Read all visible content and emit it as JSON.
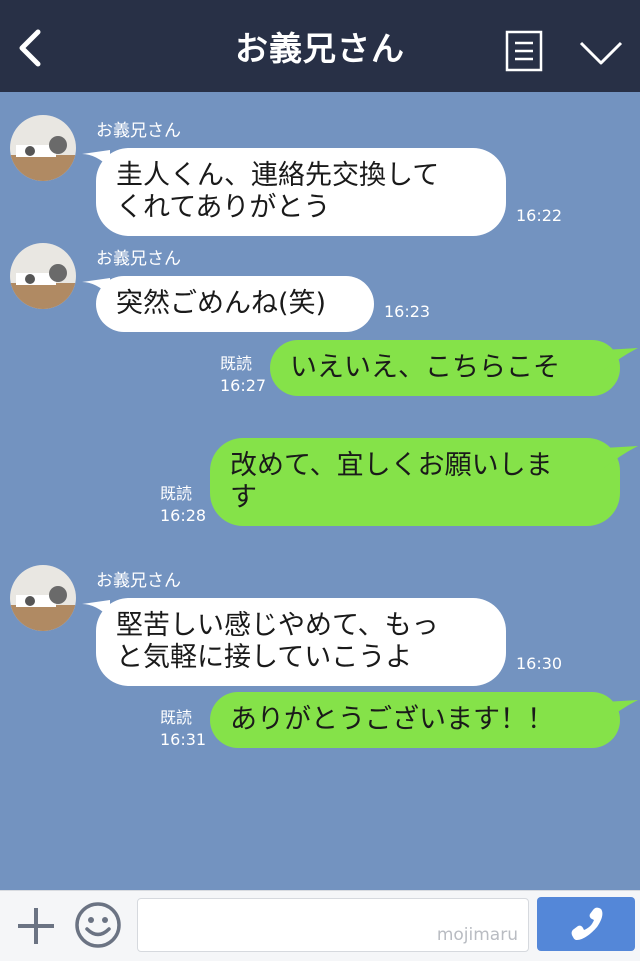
{
  "header": {
    "title": "お義兄さん"
  },
  "messages": [
    {
      "sender": "お義兄さん",
      "lines": [
        "圭人くん、連絡先交換して",
        "くれてありがとう"
      ],
      "time": "16:22"
    },
    {
      "sender": "お義兄さん",
      "lines": [
        "突然ごめんね(笑)"
      ],
      "time": "16:23"
    },
    {
      "read": "既読",
      "lines": [
        "いえいえ、こちらこそ"
      ],
      "time": "16:27"
    },
    {
      "read": "既読",
      "lines": [
        "改めて、宜しくお願いしま",
        "す"
      ],
      "time": "16:28"
    },
    {
      "sender": "お義兄さん",
      "lines": [
        "堅苦しい感じやめて、もっ",
        "と気軽に接していこうよ"
      ],
      "time": "16:30"
    },
    {
      "read": "既読",
      "lines": [
        "ありがとうございます！！"
      ],
      "time": "16:31"
    }
  ],
  "input": {
    "watermark": "mojimaru"
  },
  "colors": {
    "header": "#283046",
    "background": "#7393c0",
    "incoming": "#ffffff",
    "outgoing": "#85e249",
    "send": "#5487d8"
  },
  "icons": [
    "back-icon",
    "menu-icon",
    "chevron-down-icon",
    "plus-icon",
    "smile-icon",
    "phone-icon"
  ]
}
